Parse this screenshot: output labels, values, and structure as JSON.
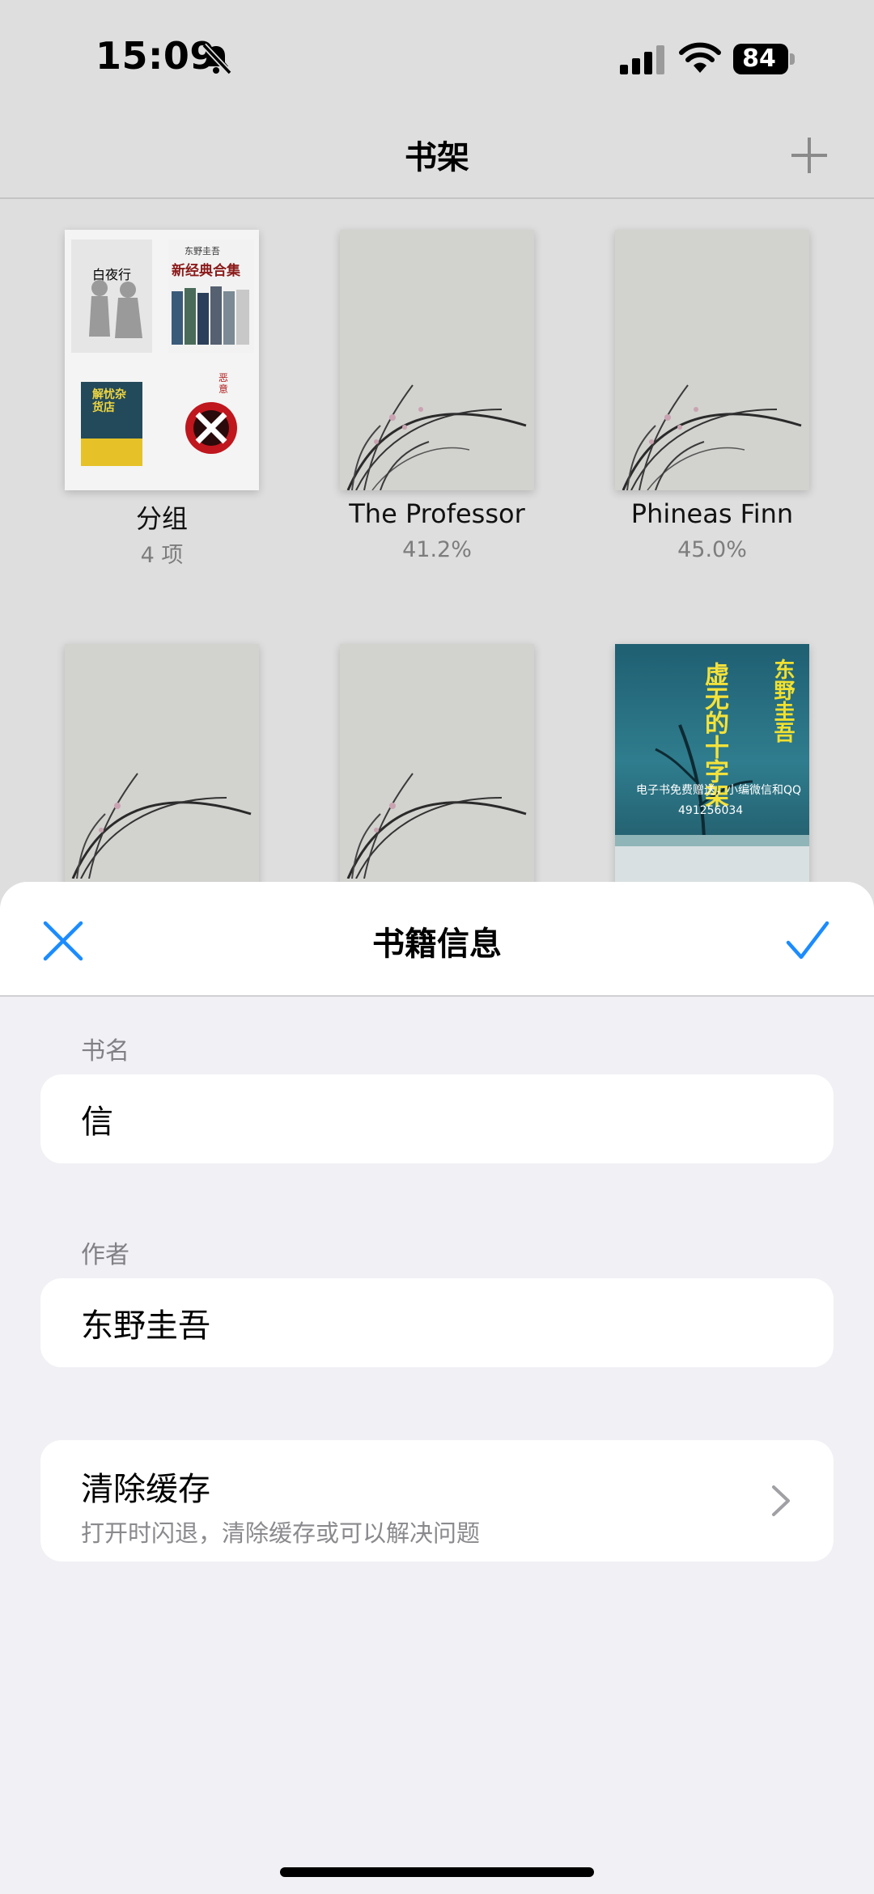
{
  "status_bar": {
    "time": "15:09",
    "battery": "84",
    "icons": [
      "bell-slash-icon",
      "signal-icon",
      "wifi-icon",
      "battery-icon"
    ]
  },
  "nav": {
    "title": "书架",
    "add_icon": "plus-icon"
  },
  "shelf": {
    "items": [
      {
        "title": "分组",
        "subtitle": "4 项"
      },
      {
        "title": "The Professor",
        "subtitle": "41.2%"
      },
      {
        "title": "Phineas Finn",
        "subtitle": "45.0%"
      }
    ],
    "group_cover": {
      "book1_label": "白夜行",
      "book2_author": "东野圭吾",
      "book2_title": "新经典合集",
      "book3_title": "解忧杂货店",
      "book4_title": "恶意"
    },
    "blue_cover": {
      "author": "东野圭吾",
      "title": "虚无的十字架",
      "promo": "电子书免费赠送，小编微信和QQ",
      "promo_number": "491256034"
    }
  },
  "sheet": {
    "title": "书籍信息",
    "close_icon": "close-icon",
    "confirm_icon": "checkmark-icon",
    "book_name_label": "书名",
    "book_name_value": "信",
    "author_label": "作者",
    "author_value": "东野圭吾",
    "clear_cache_title": "清除缓存",
    "clear_cache_desc": "打开时闪退，清除缓存或可以解决问题"
  },
  "colors": {
    "accent": "#1a8cff",
    "background": "#dedede",
    "sheet_background": "#f0f0f5"
  }
}
